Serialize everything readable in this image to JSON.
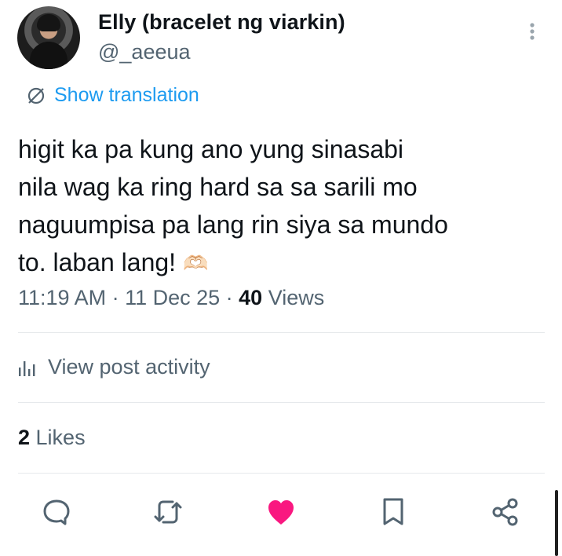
{
  "author": {
    "display_name": "Elly (bracelet ng viarkin)",
    "handle": "@_aeeua"
  },
  "translation_label": "Show translation",
  "post": {
    "text": "higit ka pa kung ano yung sinasabi\nnila wag ka ring hard sa sa sarili mo\nnaguumpisa pa lang rin siya sa mundo\nto. laban lang! ",
    "emoji": "🫶🏻"
  },
  "meta": {
    "time": "11:19 AM",
    "separator": " · ",
    "date": "11 Dec 25",
    "views_count": "40",
    "views_label": " Views"
  },
  "activity_label": "View post activity",
  "likes": {
    "count": "2",
    "label": " Likes"
  },
  "actions": {
    "reply_icon": "reply-icon",
    "repost_icon": "repost-icon",
    "like_icon": "like-icon",
    "bookmark_icon": "bookmark-icon",
    "share_icon": "share-icon"
  },
  "colors": {
    "accent": "#1d9bf0",
    "like": "#f91880",
    "muted": "#536471",
    "text": "#0f1419"
  }
}
